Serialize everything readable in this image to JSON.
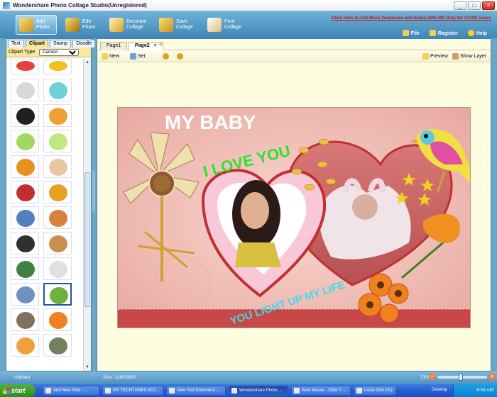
{
  "window": {
    "title": "Wondershare Photo Collage Studio(Unregistered)"
  },
  "toolbar": {
    "add_photo": "Add Photo",
    "edit_photo": "Edit Photo",
    "decorate": "Decorate Collage",
    "save": "Save Collage",
    "print": "Print Collage",
    "promo": "Click Here to Get More Templates and Enjoy 50% Off Only for GOTD Users",
    "file": "File",
    "register": "Register",
    "help": "Help"
  },
  "left_panel": {
    "tabs": [
      "Text",
      "Clipart",
      "Stamp",
      "Doodle"
    ],
    "clip_type_label": "Clipart Type",
    "clip_type_value": "Cartoon"
  },
  "workspace": {
    "tabs": [
      "Page1",
      "Page2"
    ],
    "new": "New",
    "set": "Set",
    "preview": "Preview",
    "show_layer": "Show Layer"
  },
  "collage": {
    "title_text": "MY BABY",
    "love_text": "I LOVE YOU",
    "caption_text": "YOU LIGHT UP MY LIFE"
  },
  "status": {
    "doc": "Untitled",
    "size": "Size: 1280X800",
    "zoom": "71%"
  },
  "taskbar": {
    "start": "start",
    "tasks": [
      "Add New Post ‹ ...",
      "MY TECHTUNES ACC...",
      "New Text Document -...",
      "Wondershare Photo ...",
      "Avro Mouse - Click 'n ...",
      "Local Disk (G:)"
    ],
    "desktop": "Desktop",
    "clock": "6:03 AM"
  }
}
